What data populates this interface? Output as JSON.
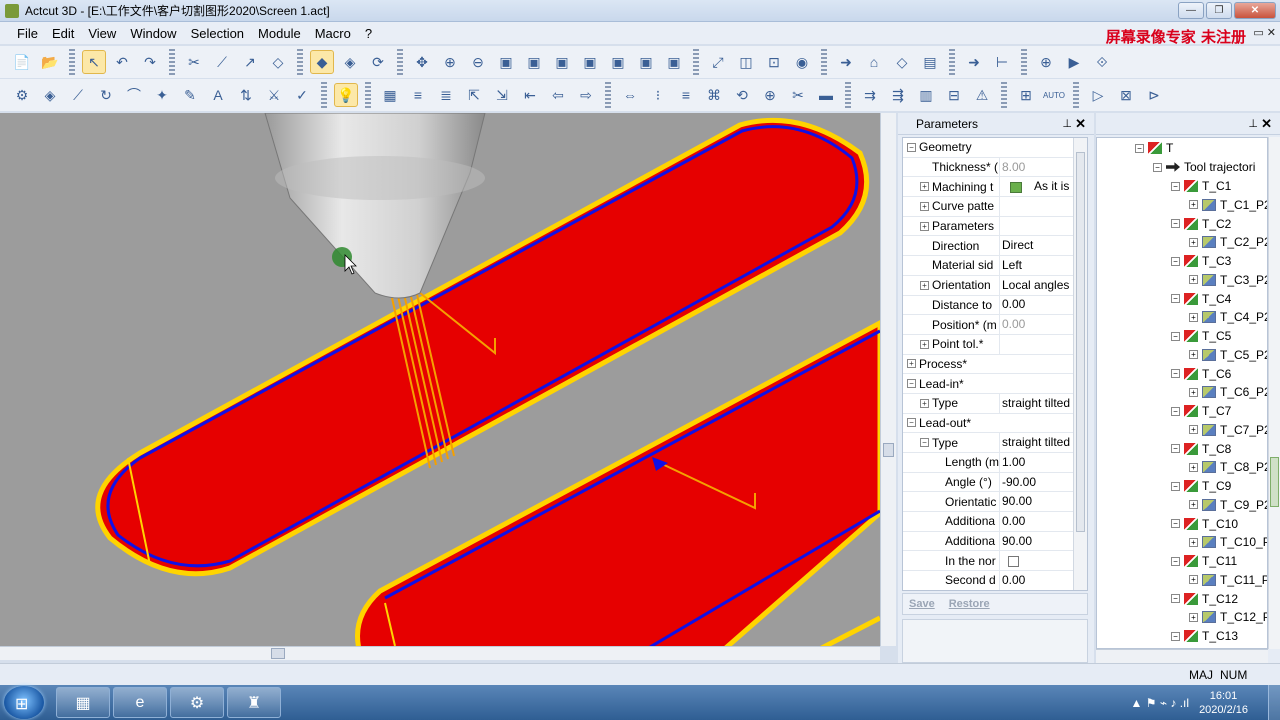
{
  "window": {
    "title": "Actcut 3D - [E:\\工作文件\\客户切割图形2020\\Screen 1.act]",
    "controls": [
      "—",
      "❐",
      "✕"
    ]
  },
  "menu": [
    "File",
    "Edit",
    "View",
    "Window",
    "Selection",
    "Module",
    "Macro",
    "?"
  ],
  "watermark": "屏幕录像专家  未注册",
  "mdi_controls": "▭ ✕",
  "toolbar1": [
    "📄",
    "📂",
    "↖",
    "↶",
    "↷",
    "✂",
    "⟋",
    "↗",
    "◇",
    "◆",
    "◈",
    "⟳",
    "✥",
    "⊕",
    "⊖",
    "▣",
    "▣",
    "▣",
    "▣",
    "▣",
    "▣",
    "▣",
    "⤢",
    "◫",
    "⊡",
    "◉",
    "➜",
    "⌂",
    "◇",
    "▤",
    "➜",
    "⊢",
    "⊕",
    "▶",
    "⟐"
  ],
  "toolbar2": [
    "⚙",
    "◈",
    "⟋",
    "↻",
    "⌒",
    "✦",
    "✎",
    "A",
    "⇅",
    "⚔",
    "✓",
    "💡",
    "▦",
    "≡",
    "≣",
    "⇱",
    "⇲",
    "⇤",
    "⇦",
    "⇨",
    "⇔",
    "⁝",
    "≡",
    "⌘",
    "⟲",
    "⊕",
    "✂",
    "▬",
    "⇉",
    "⇶",
    "▥",
    "⊟",
    "⚠",
    "⊞",
    "AUTO",
    "▷",
    "⊠",
    "⊳"
  ],
  "params": {
    "title": "Parameters",
    "pin": "⊥",
    "close": "✕",
    "rows": [
      {
        "name": "Geometry",
        "value": "",
        "indent": 0,
        "expander": "−",
        "cat": true
      },
      {
        "name": "Thickness* (",
        "value": "8.00",
        "indent": 1,
        "expander": "",
        "disabled": true
      },
      {
        "name": "Machining t",
        "value": "As it is",
        "indent": 1,
        "expander": "+",
        "swatch": true
      },
      {
        "name": "Curve patte",
        "value": "",
        "indent": 1,
        "expander": "+"
      },
      {
        "name": "Parameters",
        "value": "",
        "indent": 1,
        "expander": "+"
      },
      {
        "name": "Direction",
        "value": "Direct",
        "indent": 1,
        "expander": ""
      },
      {
        "name": "Material sid",
        "value": "Left",
        "indent": 1,
        "expander": ""
      },
      {
        "name": "Orientation",
        "value": "Local angles",
        "indent": 1,
        "expander": "+"
      },
      {
        "name": "Distance to",
        "value": "0.00",
        "indent": 1,
        "expander": ""
      },
      {
        "name": "Position* (m",
        "value": "0.00",
        "indent": 1,
        "expander": "",
        "disabled": true
      },
      {
        "name": "Point tol.*",
        "value": "",
        "indent": 1,
        "expander": "+"
      },
      {
        "name": "Process*",
        "value": "",
        "indent": 0,
        "expander": "+",
        "cat": true
      },
      {
        "name": "Lead-in*",
        "value": "",
        "indent": 0,
        "expander": "−",
        "cat": true
      },
      {
        "name": "Type",
        "value": "straight tilted",
        "indent": 1,
        "expander": "+"
      },
      {
        "name": "Lead-out*",
        "value": "",
        "indent": 0,
        "expander": "−",
        "cat": true
      },
      {
        "name": "Type",
        "value": "straight tilted",
        "indent": 1,
        "expander": "−"
      },
      {
        "name": "Length (m",
        "value": "1.00",
        "indent": 2,
        "expander": ""
      },
      {
        "name": "Angle (°)",
        "value": "-90.00",
        "indent": 2,
        "expander": ""
      },
      {
        "name": "Orientatic",
        "value": "90.00",
        "indent": 2,
        "expander": ""
      },
      {
        "name": "Additiona",
        "value": "0.00",
        "indent": 2,
        "expander": ""
      },
      {
        "name": "Additiona",
        "value": "90.00",
        "indent": 2,
        "expander": ""
      },
      {
        "name": "In the nor",
        "value": "",
        "indent": 2,
        "expander": "",
        "checkbox": true
      },
      {
        "name": "Second d",
        "value": "0.00",
        "indent": 2,
        "expander": ""
      }
    ],
    "save": "Save",
    "restore": "Restore"
  },
  "tree": {
    "pin": "⊥",
    "close": "✕",
    "root": "T",
    "trajectory_label": "Tool trajectori",
    "items": [
      {
        "name": "T_C1",
        "child": "T_C1_P2"
      },
      {
        "name": "T_C2",
        "child": "T_C2_P2"
      },
      {
        "name": "T_C3",
        "child": "T_C3_P2"
      },
      {
        "name": "T_C4",
        "child": "T_C4_P2"
      },
      {
        "name": "T_C5",
        "child": "T_C5_P2"
      },
      {
        "name": "T_C6",
        "child": "T_C6_P2"
      },
      {
        "name": "T_C7",
        "child": "T_C7_P2"
      },
      {
        "name": "T_C8",
        "child": "T_C8_P2"
      },
      {
        "name": "T_C9",
        "child": "T_C9_P2"
      },
      {
        "name": "T_C10",
        "child": "T_C10_P"
      },
      {
        "name": "T_C11",
        "child": "T_C11_P"
      },
      {
        "name": "T_C12",
        "child": "T_C12_P"
      },
      {
        "name": "T_C13",
        "child": ""
      }
    ]
  },
  "status": {
    "maj": "MAJ",
    "num": "NUM"
  },
  "taskbar": {
    "start": "⊞",
    "apps": [
      "▦",
      "e",
      "⚙",
      "♜"
    ],
    "tray": "▲  ⚑  ⌁  ♪  .ıl",
    "time": "16:01",
    "date": "2020/2/16"
  },
  "colors": {
    "part_fill": "#e60000",
    "part_edge": "#ffd400",
    "tool_path": "#1010e6",
    "viewport_bg": "#9c9c9c",
    "lead_line": "#f5a000"
  }
}
